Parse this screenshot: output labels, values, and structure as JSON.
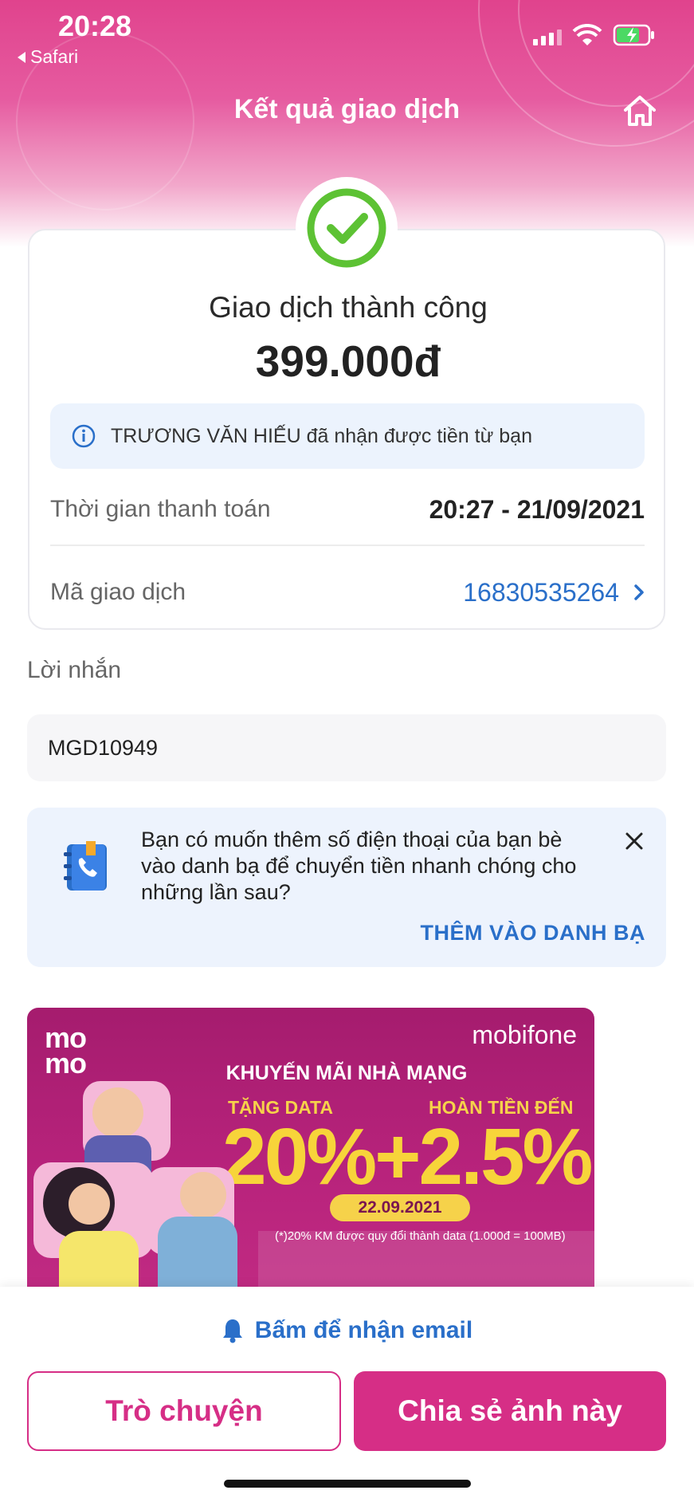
{
  "status_bar": {
    "time": "20:28",
    "back_app": "Safari"
  },
  "header": {
    "title": "Kết quả giao dịch"
  },
  "result": {
    "title": "Giao dịch thành công",
    "amount": "399.000đ",
    "info": "TRƯƠNG VĂN HIẾU đã nhận được tiền từ bạn",
    "time_label": "Thời gian thanh toán",
    "time_value": "20:27 - 21/09/2021",
    "txn_label": "Mã giao dịch",
    "txn_value": "16830535264"
  },
  "message": {
    "label": "Lời nhắn",
    "value": "MGD10949"
  },
  "contact_prompt": {
    "text": "Bạn có muốn thêm số điện thoại của bạn bè vào danh bạ để chuyển tiền nhanh chóng cho những lần sau?",
    "action": "THÊM VÀO DANH BẠ"
  },
  "banner": {
    "logo": "mo mo",
    "brand": "mobifone",
    "headline": "KHUYẾN MÃI NHÀ MẠNG",
    "sub_left": "TẶNG DATA",
    "sub_right": "HOÀN TIỀN ĐẾN",
    "big": "20%+2.5%",
    "date": "22.09.2021",
    "note": "(*)20% KM được quy đổi thành data (1.000đ = 100MB)"
  },
  "footer": {
    "email_link": "Bấm để nhận email",
    "chat_button": "Trò chuyện",
    "share_button": "Chia sẻ ảnh này"
  },
  "colors": {
    "brand": "#d62e86",
    "link": "#2a6fc9",
    "success": "#5dc234"
  },
  "icons": [
    "home-icon",
    "check-icon",
    "info-icon",
    "chevron-right-icon",
    "contact-book-icon",
    "close-icon",
    "bell-icon"
  ]
}
